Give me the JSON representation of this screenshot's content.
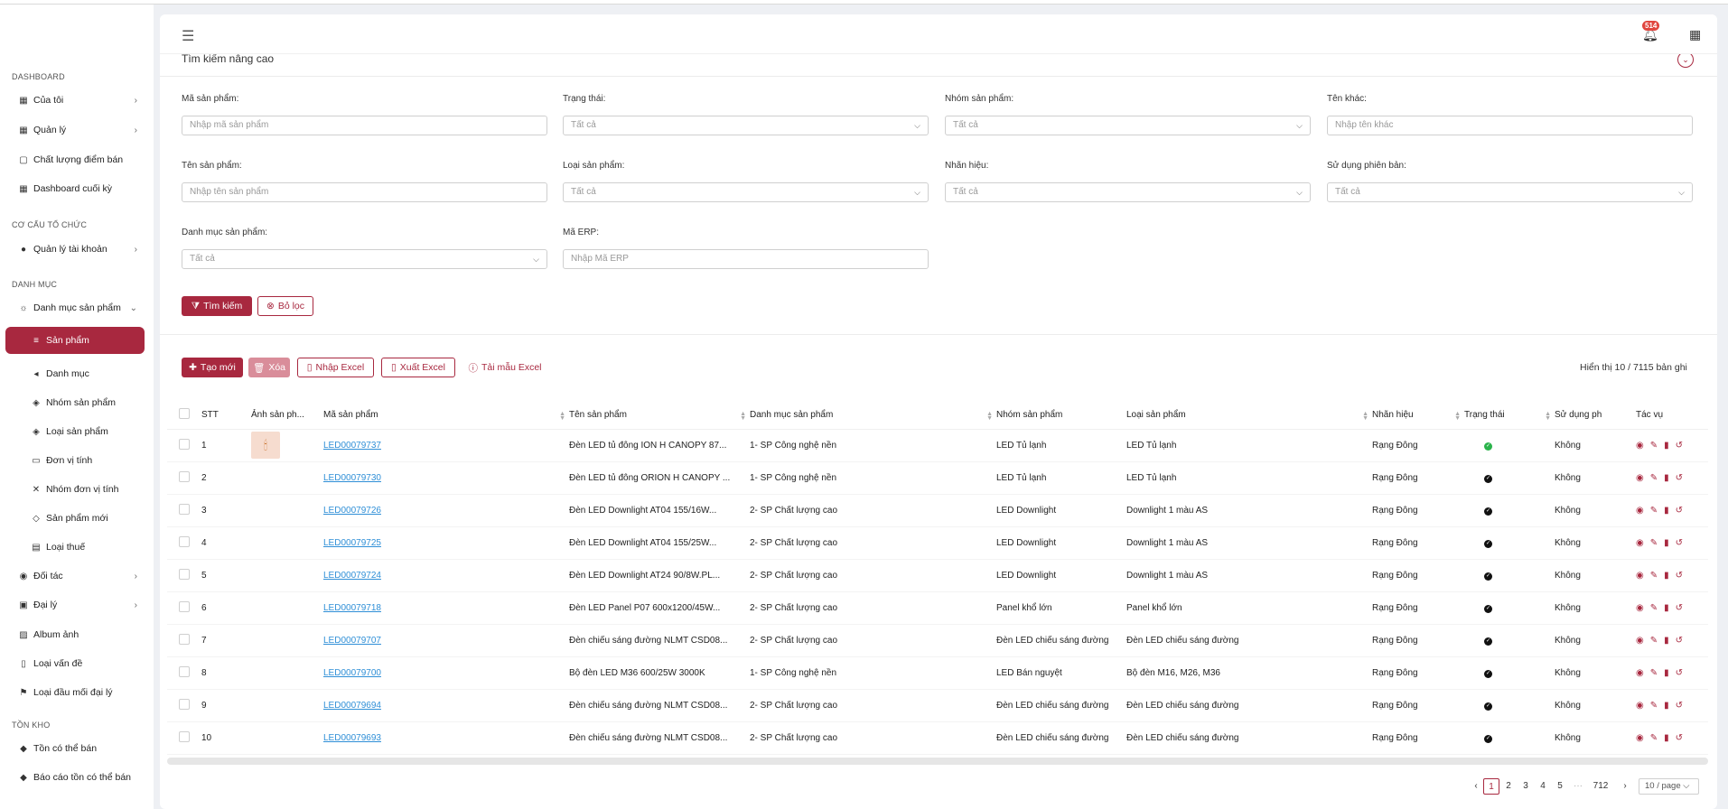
{
  "sidebar": {
    "sections": [
      "DASHBOARD",
      "CƠ CẤU TỔ CHỨC",
      "DANH MỤC",
      "TỒN KHO"
    ],
    "items": [
      {
        "label": "Của tôi"
      },
      {
        "label": "Quản lý"
      },
      {
        "label": "Chất lượng điểm bán"
      },
      {
        "label": "Dashboard cuối kỳ"
      },
      {
        "label": "Quản lý tài khoản"
      },
      {
        "label": "Danh mục sản phẩm"
      },
      {
        "label": "Sản phẩm"
      },
      {
        "label": "Danh mục"
      },
      {
        "label": "Nhóm sản phẩm"
      },
      {
        "label": "Loại sản phẩm"
      },
      {
        "label": "Đơn vị tính"
      },
      {
        "label": "Nhóm đơn vị tính"
      },
      {
        "label": "Sản phẩm mới"
      },
      {
        "label": "Loại thuế"
      },
      {
        "label": "Đối tác"
      },
      {
        "label": "Đại lý"
      },
      {
        "label": "Album ảnh"
      },
      {
        "label": "Loại vấn đề"
      },
      {
        "label": "Loại đầu mối đại lý"
      },
      {
        "label": "Tồn có thể bán"
      },
      {
        "label": "Báo cáo tồn có thể bán"
      }
    ]
  },
  "header": {
    "notification_count": "514"
  },
  "filters": {
    "title": "Tìm kiếm nâng cao",
    "fields": [
      {
        "label": "Mã sản phẩm:",
        "placeholder": "Nhập mã sản phẩm"
      },
      {
        "label": "Trạng thái:",
        "placeholder": "Tất cả"
      },
      {
        "label": "Nhóm sản phẩm:",
        "placeholder": "Tất cả"
      },
      {
        "label": "Tên khác:",
        "placeholder": "Nhập tên khác"
      },
      {
        "label": "Tên sản phẩm:",
        "placeholder": "Nhập tên sản phẩm"
      },
      {
        "label": "Loại sản phẩm:",
        "placeholder": "Tất cả"
      },
      {
        "label": "Nhãn hiệu:",
        "placeholder": "Tất cả"
      },
      {
        "label": "Sử dụng phiên bản:",
        "placeholder": "Tất cả"
      },
      {
        "label": "Danh mục sản phẩm:",
        "placeholder": "Tất cả"
      },
      {
        "label": "Mã ERP:",
        "placeholder": "Nhập Mã ERP"
      }
    ],
    "search_label": "Tìm kiếm",
    "clear_label": "Bỏ lọc"
  },
  "toolbar": {
    "create_label": "Tạo mới",
    "delete_label": "Xóa",
    "import_label": "Nhập Excel",
    "export_label": "Xuất Excel",
    "template_label": "Tải mẫu Excel",
    "count_text": "Hiển thị 10 / 7115 bản ghi"
  },
  "table": {
    "headers": [
      "STT",
      "Ảnh sản ph...",
      "Mã sản phẩm",
      "Tên sản phẩm",
      "Danh mục sản phẩm",
      "Nhóm sản phẩm",
      "Loại sản phẩm",
      "Nhãn hiệu",
      "Trạng thái",
      "Sử dụng ph",
      "Tác vụ"
    ],
    "rows": [
      {
        "stt": "1",
        "code": "LED00079737",
        "name": "Đèn LED tủ đông ION H CANOPY 87...",
        "category": "1- SP Công nghệ nền",
        "group": "LED Tủ lạnh",
        "type": "LED Tủ lạnh",
        "brand": "Rạng Đông",
        "status": "green",
        "use": "Không",
        "has_image": true
      },
      {
        "stt": "2",
        "code": "LED00079730",
        "name": "Đèn LED tủ đông ORION H CANOPY ...",
        "category": "1- SP Công nghệ nền",
        "group": "LED Tủ lạnh",
        "type": "LED Tủ lạnh",
        "brand": "Rạng Đông",
        "status": "black",
        "use": "Không",
        "has_image": false
      },
      {
        "stt": "3",
        "code": "LED00079726",
        "name": "Đèn LED Downlight AT04 155/16W...",
        "category": "2- SP Chất lượng cao",
        "group": "LED Downlight",
        "type": "Downlight 1 màu AS",
        "brand": "Rạng Đông",
        "status": "black",
        "use": "Không",
        "has_image": false
      },
      {
        "stt": "4",
        "code": "LED00079725",
        "name": "Đèn LED Downlight AT04 155/25W...",
        "category": "2- SP Chất lượng cao",
        "group": "LED Downlight",
        "type": "Downlight 1 màu AS",
        "brand": "Rạng Đông",
        "status": "black",
        "use": "Không",
        "has_image": false
      },
      {
        "stt": "5",
        "code": "LED00079724",
        "name": "Đèn LED Downlight AT24 90/8W.PL...",
        "category": "2- SP Chất lượng cao",
        "group": "LED Downlight",
        "type": "Downlight 1 màu AS",
        "brand": "Rạng Đông",
        "status": "black",
        "use": "Không",
        "has_image": false
      },
      {
        "stt": "6",
        "code": "LED00079718",
        "name": "Đèn LED Panel P07 600x1200/45W...",
        "category": "2- SP Chất lượng cao",
        "group": "Panel khổ lớn",
        "type": "Panel khổ lớn",
        "brand": "Rạng Đông",
        "status": "black",
        "use": "Không",
        "has_image": false
      },
      {
        "stt": "7",
        "code": "LED00079707",
        "name": "Đèn chiếu sáng đường NLMT CSD08...",
        "category": "2- SP Chất lượng cao",
        "group": "Đèn LED chiếu sáng đường",
        "type": "Đèn LED chiếu sáng đường",
        "brand": "Rạng Đông",
        "status": "black",
        "use": "Không",
        "has_image": false
      },
      {
        "stt": "8",
        "code": "LED00079700",
        "name": "Bộ đèn LED M36 600/25W 3000K",
        "category": "1- SP Công nghệ nền",
        "group": "LED Bán nguyệt",
        "type": "Bộ đèn M16, M26, M36",
        "brand": "Rạng Đông",
        "status": "black",
        "use": "Không",
        "has_image": false
      },
      {
        "stt": "9",
        "code": "LED00079694",
        "name": "Đèn chiếu sáng đường NLMT CSD08...",
        "category": "2- SP Chất lượng cao",
        "group": "Đèn LED chiếu sáng đường",
        "type": "Đèn LED chiếu sáng đường",
        "brand": "Rạng Đông",
        "status": "black",
        "use": "Không",
        "has_image": false
      },
      {
        "stt": "10",
        "code": "LED00079693",
        "name": "Đèn chiếu sáng đường NLMT CSD08...",
        "category": "2- SP Chất lượng cao",
        "group": "Đèn LED chiếu sáng đường",
        "type": "Đèn LED chiếu sáng đường",
        "brand": "Rạng Đông",
        "status": "black",
        "use": "Không",
        "has_image": false
      }
    ]
  },
  "pagination": {
    "pages": [
      "1",
      "2",
      "3",
      "4",
      "5",
      "···",
      "712"
    ],
    "current": "1",
    "page_size": "10 / page"
  }
}
